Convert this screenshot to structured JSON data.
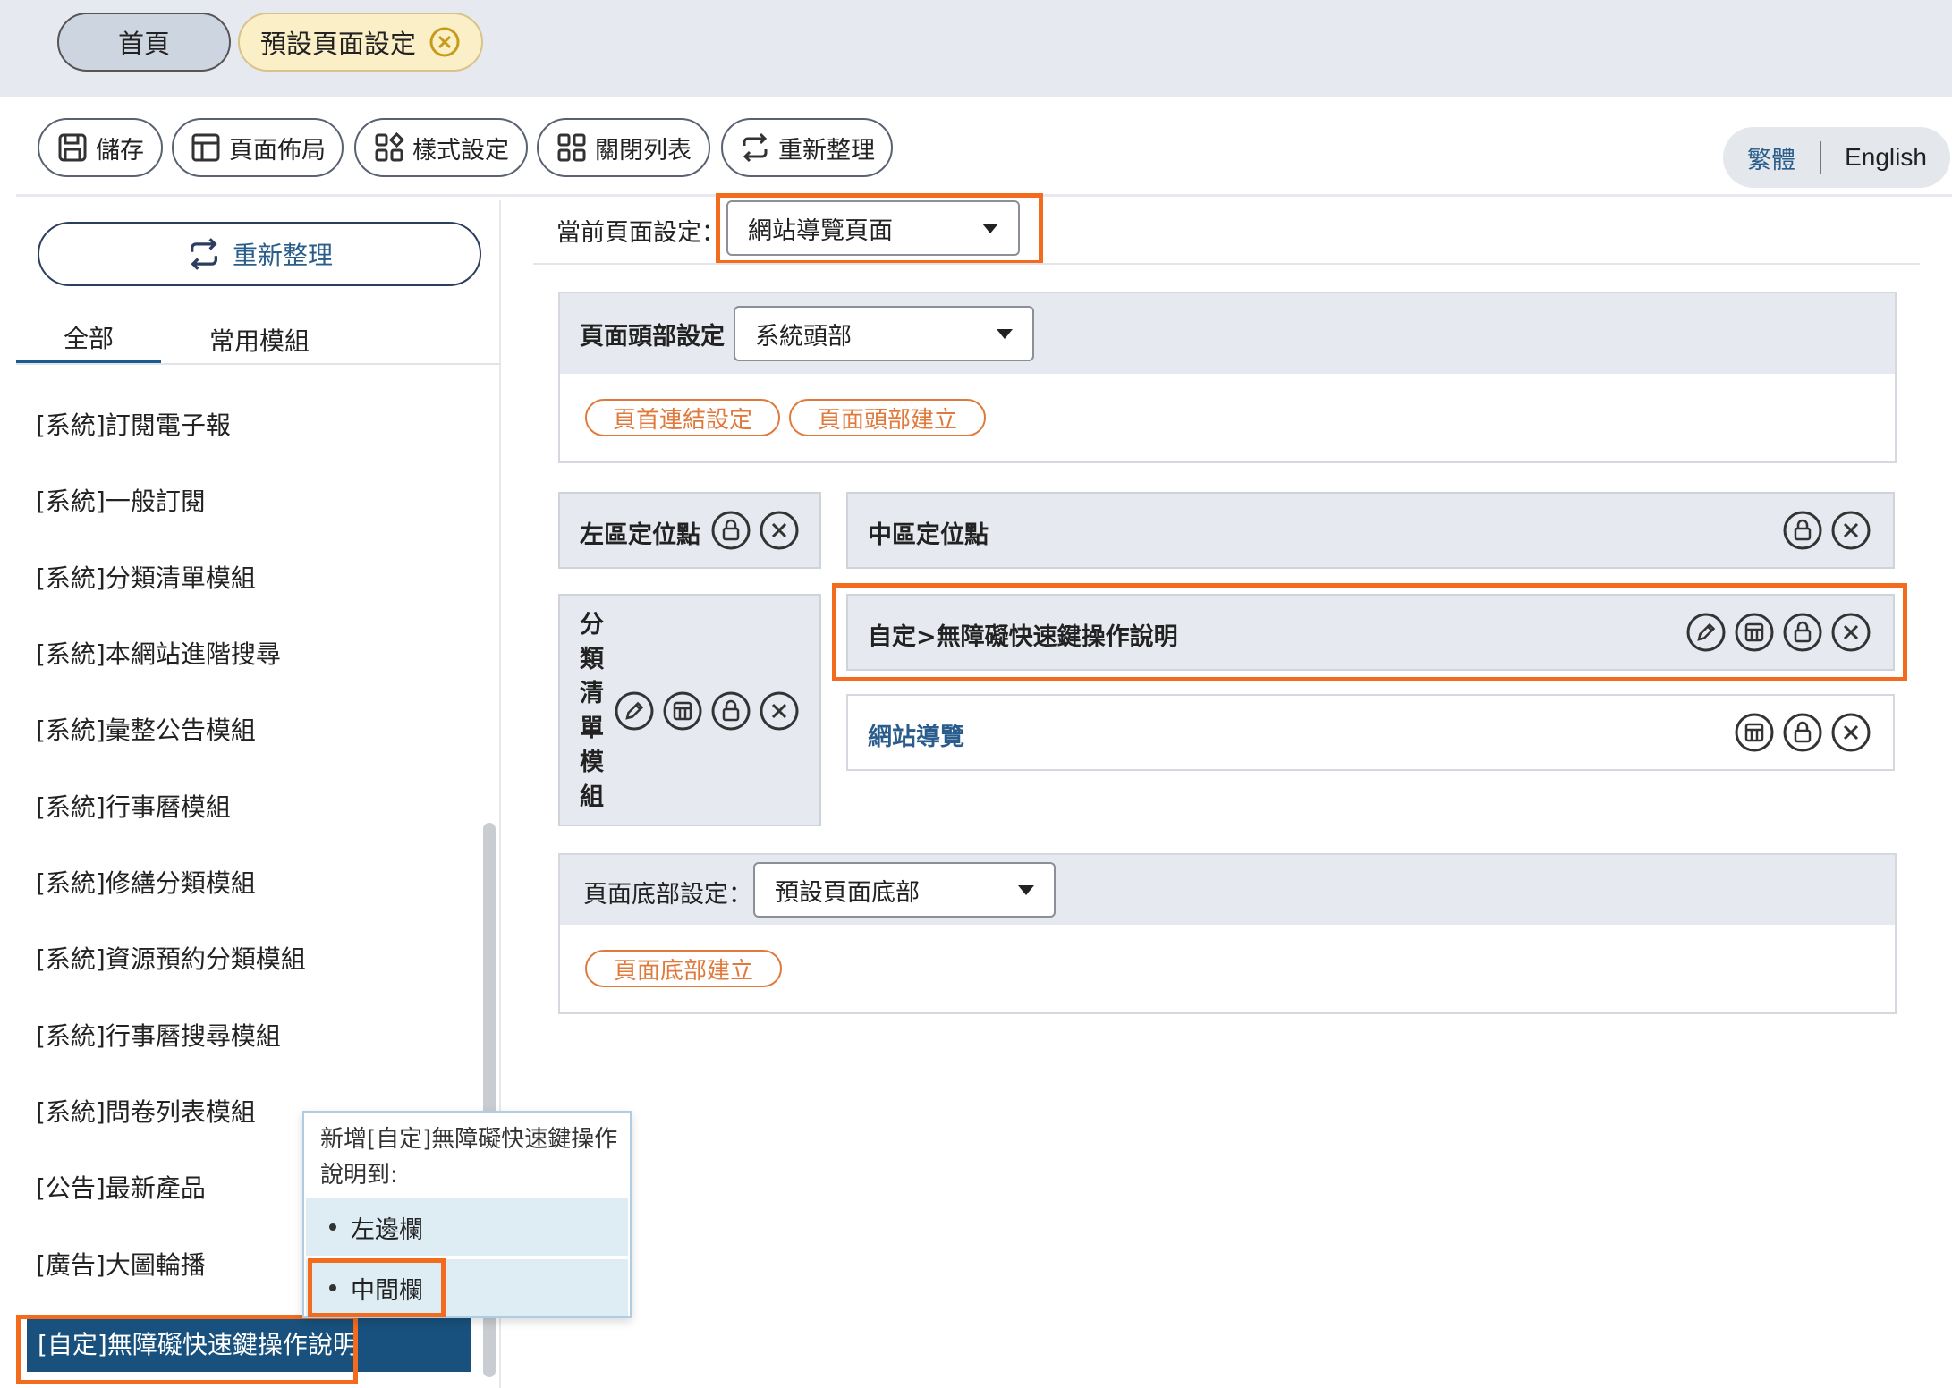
{
  "tabs": [
    {
      "label": "首頁"
    },
    {
      "label": "預設頁面設定"
    }
  ],
  "toolbar": {
    "save": "儲存",
    "layout": "頁面佈局",
    "style": "樣式設定",
    "close_list": "關閉列表",
    "refresh": "重新整理"
  },
  "language": {
    "zh": "繁體",
    "en": "English"
  },
  "sidebar": {
    "refresh": "重新整理",
    "tab_all": "全部",
    "tab_common": "常用模組",
    "modules": [
      "[系統]訂閱電子報",
      "[系統]一般訂閱",
      "[系統]分類清單模組",
      "[系統]本網站進階搜尋",
      "[系統]彙整公告模組",
      "[系統]行事曆模組",
      "[系統]修繕分類模組",
      "[系統]資源預約分類模組",
      "[系統]行事曆搜尋模組",
      "[系統]問卷列表模組",
      "[公告]最新產品",
      "[廣告]大圖輪播"
    ],
    "selected_module": "[自定]無障礙快速鍵操作說明"
  },
  "popup": {
    "title": "新增[自定]無障礙快速鍵操作說明到:",
    "items": [
      "左邊欄",
      "中間欄"
    ]
  },
  "main": {
    "current_label": "當前頁面設定：",
    "current_value": "網站導覽頁面",
    "header": {
      "label": "頁面頭部設定",
      "value": "系統頭部",
      "btn_link": "頁首連結設定",
      "btn_build": "頁面頭部建立"
    },
    "left_zone": {
      "title": "左區定位點",
      "module": "分類清單模組"
    },
    "center_zone": {
      "title": "中區定位點",
      "module_custom": "自定>無障礙快速鍵操作說明",
      "module_sitemap": "網站導覽"
    },
    "footer": {
      "label": "頁面底部設定：",
      "value": "預設頁面底部",
      "btn_build": "頁面底部建立"
    }
  }
}
